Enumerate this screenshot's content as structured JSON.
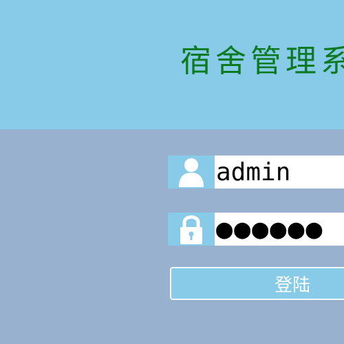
{
  "header": {
    "title": "宿舍管理系统"
  },
  "login_form": {
    "username": {
      "icon": "user-icon",
      "value": "admin"
    },
    "password": {
      "icon": "lock-icon",
      "value": "●●●●●●"
    },
    "login_label": "登陆"
  },
  "colors": {
    "header_bg": "#87cbe9",
    "body_bg": "#97b1cf",
    "title_color": "#0d7a22",
    "icon_bg": "#87cbe9",
    "button_bg": "#87cbe9"
  }
}
